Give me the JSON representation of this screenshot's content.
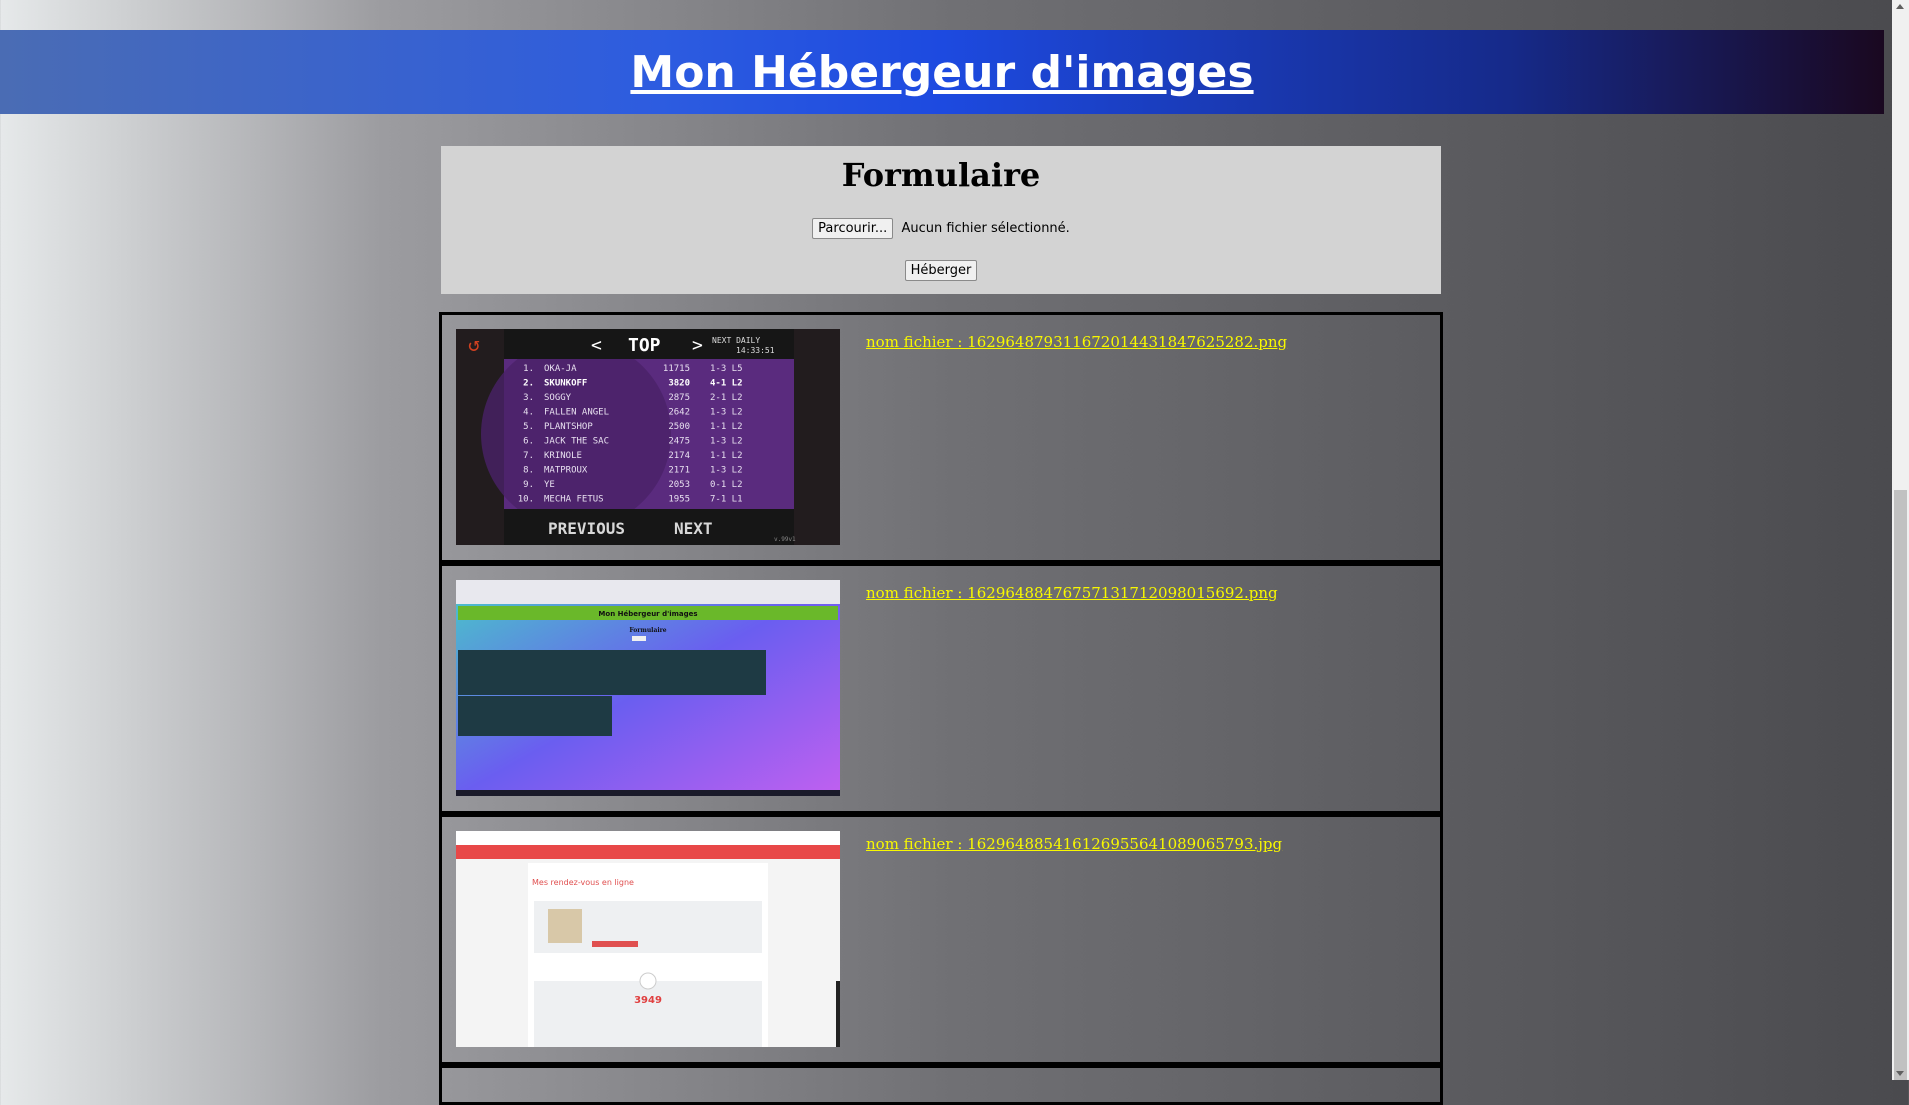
{
  "header": {
    "title": "Mon Hébergeur d'images"
  },
  "form": {
    "title": "Formulaire",
    "browse_label": "Parcourir...",
    "file_status": "Aucun fichier sélectionné.",
    "submit_label": "Héberger"
  },
  "entries": [
    {
      "filename": "nom fichier : 16296487931167201443184762528​2.png"
    },
    {
      "filename": "nom fichier : 16296488476757131712098015692.png"
    },
    {
      "filename": "nom fichier : 16296488541612695564108906579​3.jpg"
    }
  ],
  "thumb1": {
    "top_label": "TOP",
    "next_daily_label": "NEXT DAILY",
    "timer": "14:33:51",
    "rows": [
      [
        "1.",
        "OKA-JA",
        "11715",
        "1-3 L5"
      ],
      [
        "2.",
        "SKUNKOFF",
        "3820",
        "4-1 L2"
      ],
      [
        "3.",
        "SOGGY",
        "2875",
        "2-1 L2"
      ],
      [
        "4.",
        "FALLEN ANGEL",
        "2642",
        "1-3 L2"
      ],
      [
        "5.",
        "PLANTSHOP",
        "2500",
        "1-1 L2"
      ],
      [
        "6.",
        "JACK THE SAC",
        "2475",
        "1-3 L2"
      ],
      [
        "7.",
        "KRINOLE",
        "2174",
        "1-1 L2"
      ],
      [
        "8.",
        "MATPROUX",
        "2171",
        "1-3 L2"
      ],
      [
        "9.",
        "YE",
        "2053",
        "0-1 L2"
      ],
      [
        "10.",
        "MECHA FETUS",
        "1955",
        "7-1 L1"
      ]
    ],
    "previous_label": "PREVIOUS",
    "next_label": "NEXT",
    "version": "v.99v1"
  },
  "thumb2": {
    "title": "Mon Hébergeur d'images",
    "form_title": "Formulaire"
  },
  "thumb3": {
    "heading": "Mes rendez-vous en ligne",
    "number": "3949"
  }
}
